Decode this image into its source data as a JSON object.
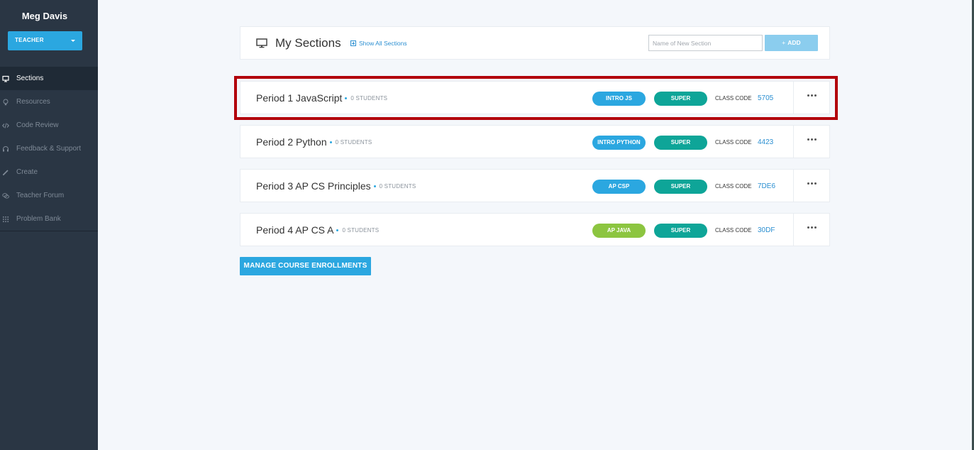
{
  "user": {
    "name": "Meg Davis",
    "role": "TEACHER"
  },
  "nav": [
    {
      "label": "Sections",
      "icon": "monitor-icon",
      "active": true
    },
    {
      "label": "Resources",
      "icon": "lightbulb-icon"
    },
    {
      "label": "Code Review",
      "icon": "code-icon"
    },
    {
      "label": "Feedback & Support",
      "icon": "headset-icon"
    },
    {
      "label": "Create",
      "icon": "pencil-icon"
    },
    {
      "label": "Teacher Forum",
      "icon": "chat-icon"
    },
    {
      "label": "Problem Bank",
      "icon": "grid-icon"
    }
  ],
  "header": {
    "title": "My Sections",
    "show_all": "Show All Sections",
    "input_placeholder": "Name of New Section",
    "add_label": "ADD"
  },
  "sections": [
    {
      "name": "Period 1 JavaScript",
      "students": "0 STUDENTS",
      "course": "INTRO JS",
      "course_color": "#2ba7e0",
      "tier": "SUPER",
      "code_label": "CLASS CODE",
      "code": "5705"
    },
    {
      "name": "Period 2 Python",
      "students": "0 STUDENTS",
      "course": "INTRO PYTHON",
      "course_color": "#2ba7e0",
      "tier": "SUPER",
      "code_label": "CLASS CODE",
      "code": "4423"
    },
    {
      "name": "Period 3 AP CS Principles",
      "students": "0 STUDENTS",
      "course": "AP CSP",
      "course_color": "#2ba7e0",
      "tier": "SUPER",
      "code_label": "CLASS CODE",
      "code": "7DE6"
    },
    {
      "name": "Period 4 AP CS A",
      "students": "0 STUDENTS",
      "course": "AP JAVA",
      "course_color": "#8cc540",
      "tier": "SUPER",
      "code_label": "CLASS CODE",
      "code": "30DF"
    }
  ],
  "manage_label": "MANAGE COURSE ENROLLMENTS",
  "colors": {
    "sidebar": "#2a3644",
    "accent": "#2ba7e0",
    "super": "#0ea598",
    "highlight": "#b2000b"
  }
}
